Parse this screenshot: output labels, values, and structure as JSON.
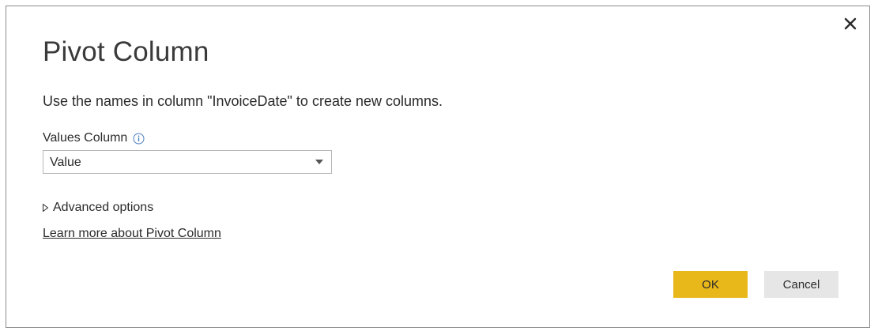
{
  "dialog": {
    "title": "Pivot Column",
    "description": "Use the names in column \"InvoiceDate\" to create new columns.",
    "values_column": {
      "label": "Values Column",
      "selected": "Value"
    },
    "advanced_options_label": "Advanced options",
    "learn_more_link": "Learn more about Pivot Column",
    "buttons": {
      "ok": "OK",
      "cancel": "Cancel"
    }
  },
  "colors": {
    "primary_button": "#e8b71a",
    "secondary_button": "#e6e6e6",
    "border": "#8c8c8c"
  },
  "icons": {
    "close": "close-icon",
    "info": "info-icon",
    "dropdown": "chevron-down-icon",
    "expand": "triangle-right-icon"
  }
}
